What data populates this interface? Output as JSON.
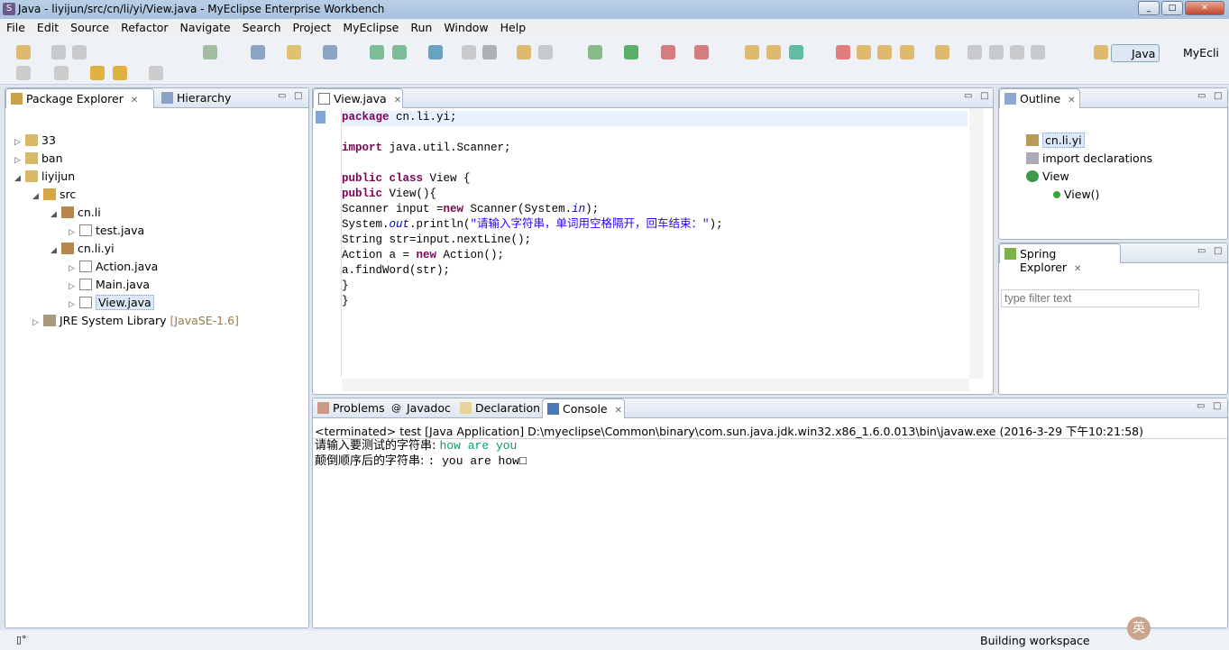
{
  "window": {
    "title": "Java - liyijun/src/cn/li/yi/View.java - MyEclipse Enterprise Workbench",
    "controls": [
      "_",
      "□",
      "✕"
    ]
  },
  "menu": [
    "File",
    "Edit",
    "Source",
    "Refactor",
    "Navigate",
    "Search",
    "Project",
    "MyEclipse",
    "Run",
    "Window",
    "Help"
  ],
  "perspectives": {
    "java": "Java",
    "myeclipse": "MyEcli"
  },
  "package_explorer": {
    "tabs": [
      "Package Explorer",
      "Hierarchy"
    ],
    "tree": [
      {
        "label": "33",
        "depth": 0,
        "arrow": "▷",
        "icon": "project-icon"
      },
      {
        "label": "ban",
        "depth": 0,
        "arrow": "▷",
        "icon": "project-icon"
      },
      {
        "label": "liyijun",
        "depth": 0,
        "arrow": "◢",
        "icon": "project-icon"
      },
      {
        "label": "src",
        "depth": 1,
        "arrow": "◢",
        "icon": "source-folder-icon"
      },
      {
        "label": "cn.li",
        "depth": 2,
        "arrow": "◢",
        "icon": "package-icon"
      },
      {
        "label": "test.java",
        "depth": 3,
        "arrow": "▷",
        "icon": "java-file-icon"
      },
      {
        "label": "cn.li.yi",
        "depth": 2,
        "arrow": "◢",
        "icon": "package-icon"
      },
      {
        "label": "Action.java",
        "depth": 3,
        "arrow": "▷",
        "icon": "java-file-icon"
      },
      {
        "label": "Main.java",
        "depth": 3,
        "arrow": "▷",
        "icon": "java-file-icon"
      },
      {
        "label": "View.java",
        "depth": 3,
        "arrow": "▷",
        "icon": "java-file-icon",
        "selected": true
      },
      {
        "label": "JRE System Library",
        "extra": "[JavaSE-1.6]",
        "depth": 1,
        "arrow": "▷",
        "icon": "library-icon"
      }
    ]
  },
  "editor": {
    "tab": "View.java",
    "lines": [
      [
        [
          "package",
          "kw"
        ],
        [
          " cn.li.yi;",
          ""
        ]
      ],
      [],
      [
        [
          "import",
          "kw"
        ],
        [
          " java.util.Scanner;",
          ""
        ]
      ],
      [],
      [
        [
          "public",
          "kw"
        ],
        [
          " ",
          ""
        ],
        [
          "class",
          "kw"
        ],
        [
          " View {",
          ""
        ]
      ],
      [
        [
          "public",
          "kw"
        ],
        [
          " View(){",
          ""
        ]
      ],
      [
        [
          "Scanner input =",
          ""
        ],
        [
          "new",
          "kw"
        ],
        [
          " Scanner(System.",
          ""
        ],
        [
          "in",
          "fld"
        ],
        [
          ");",
          ""
        ]
      ],
      [
        [
          "System.",
          ""
        ],
        [
          "out",
          "fld"
        ],
        [
          ".println(",
          ""
        ],
        [
          "\"请输入字符串，单词用空格隔开，回车结束：\"",
          "str"
        ],
        [
          ");",
          ""
        ]
      ],
      [
        [
          "String str=input.nextLine();",
          ""
        ]
      ],
      [
        [
          "Action a = ",
          ""
        ],
        [
          "new",
          "kw"
        ],
        [
          " Action();",
          ""
        ]
      ],
      [
        [
          "a.findWord(str);",
          ""
        ]
      ],
      [
        [
          "}",
          ""
        ]
      ],
      [
        [
          "}",
          ""
        ]
      ]
    ]
  },
  "outline": {
    "tab": "Outline",
    "items": [
      "cn.li.yi",
      "import declarations",
      "View",
      "View()"
    ]
  },
  "spring_explorer": {
    "tab": "Spring Explorer",
    "filter_placeholder": "type filter text"
  },
  "console": {
    "tabs": [
      "Problems",
      "Javadoc",
      "Declaration",
      "Console"
    ],
    "header": "<terminated> test [Java Application] D:\\myeclipse\\Common\\binary\\com.sun.java.jdk.win32.x86_1.6.0.013\\bin\\javaw.exe (2016-3-29 下午10:21:58)",
    "line1_prompt": "请输入要测试的字符串:",
    "line1_input": "how are you",
    "line2_prompt": "颠倒顺序后的字符串:",
    "line2_output": ": you are how□"
  },
  "status": {
    "message": "Building workspace",
    "ime": "英"
  }
}
